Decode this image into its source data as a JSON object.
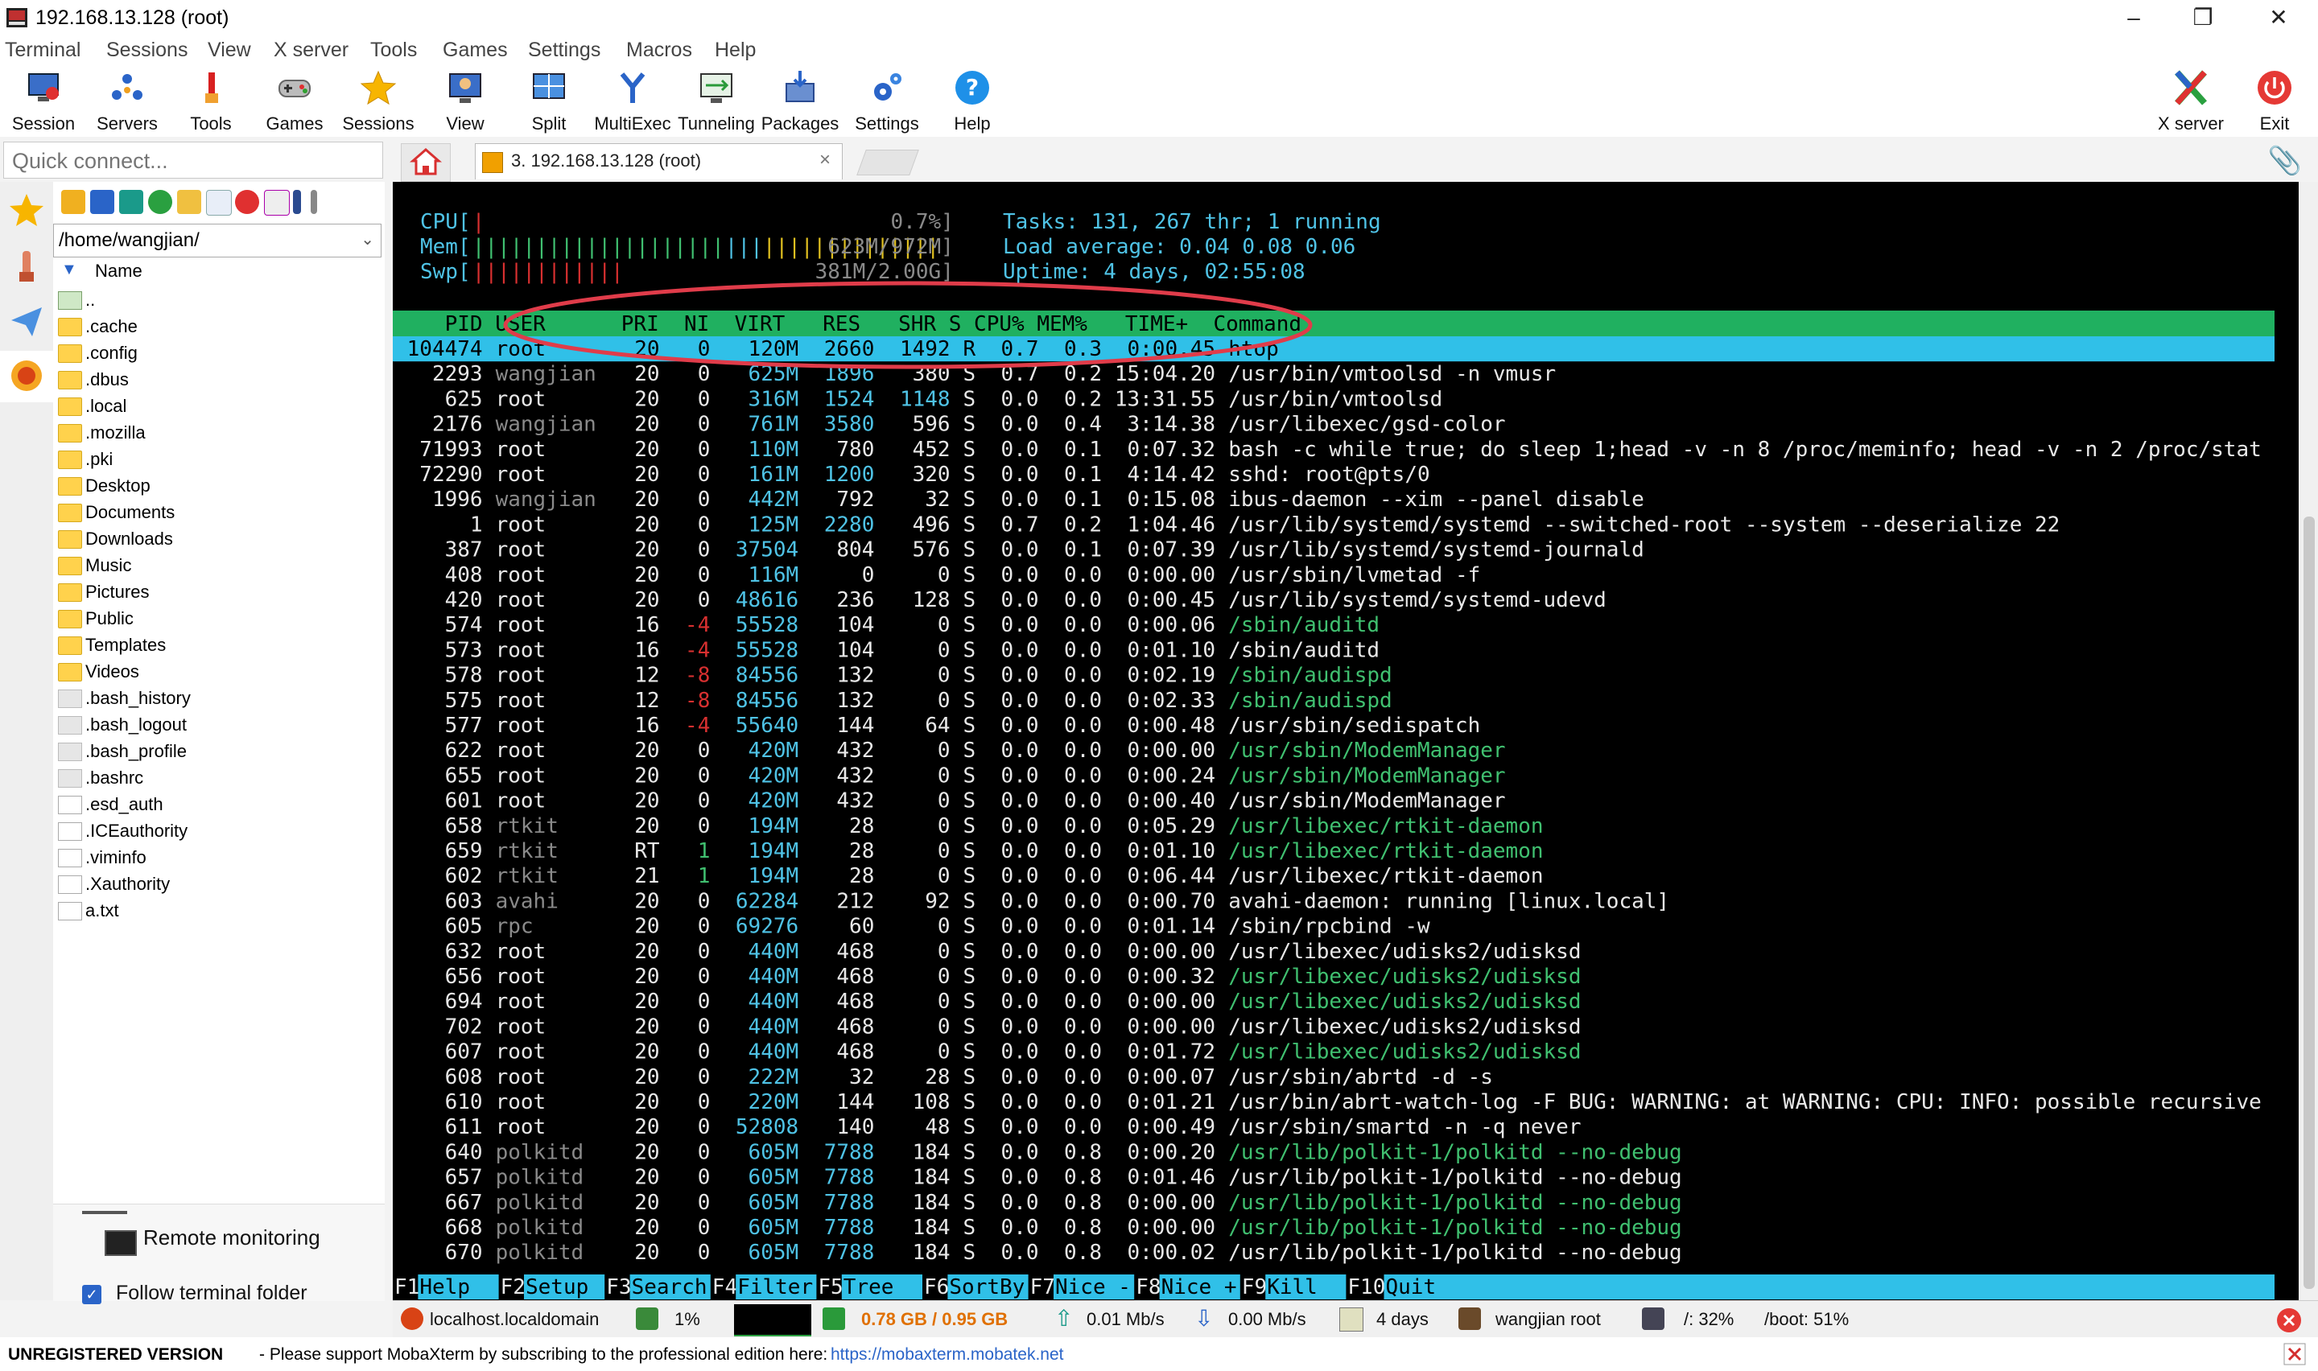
{
  "window": {
    "title": "192.168.13.128 (root)"
  },
  "menu": [
    "Terminal",
    "Sessions",
    "View",
    "X server",
    "Tools",
    "Games",
    "Settings",
    "Macros",
    "Help"
  ],
  "toolbar": {
    "left": [
      {
        "label": "Session",
        "icon": "session-icon"
      },
      {
        "label": "Servers",
        "icon": "servers-icon"
      },
      {
        "label": "Tools",
        "icon": "tools-icon"
      },
      {
        "label": "Games",
        "icon": "games-icon"
      },
      {
        "label": "Sessions",
        "icon": "star-icon"
      },
      {
        "label": "View",
        "icon": "view-icon"
      },
      {
        "label": "Split",
        "icon": "split-icon"
      },
      {
        "label": "MultiExec",
        "icon": "multiexec-icon"
      },
      {
        "label": "Tunneling",
        "icon": "tunneling-icon"
      },
      {
        "label": "Packages",
        "icon": "packages-icon"
      },
      {
        "label": "Settings",
        "icon": "settings-icon"
      },
      {
        "label": "Help",
        "icon": "help-icon"
      }
    ],
    "right": [
      {
        "label": "X server",
        "icon": "xserver-icon"
      },
      {
        "label": "Exit",
        "icon": "exit-icon"
      }
    ]
  },
  "quick_connect": {
    "placeholder": "Quick connect..."
  },
  "tab": {
    "label": "3. 192.168.13.128 (root)",
    "close": "×"
  },
  "sidebar": {
    "path": "/home/wangjian/",
    "column": "Name",
    "files": [
      {
        "name": "..",
        "kind": "up"
      },
      {
        "name": ".cache",
        "kind": "folder"
      },
      {
        "name": ".config",
        "kind": "folder"
      },
      {
        "name": ".dbus",
        "kind": "folder"
      },
      {
        "name": ".local",
        "kind": "folder"
      },
      {
        "name": ".mozilla",
        "kind": "folder"
      },
      {
        "name": ".pki",
        "kind": "folder"
      },
      {
        "name": "Desktop",
        "kind": "folder"
      },
      {
        "name": "Documents",
        "kind": "folder"
      },
      {
        "name": "Downloads",
        "kind": "folder"
      },
      {
        "name": "Music",
        "kind": "folder"
      },
      {
        "name": "Pictures",
        "kind": "folder"
      },
      {
        "name": "Public",
        "kind": "folder"
      },
      {
        "name": "Templates",
        "kind": "folder"
      },
      {
        "name": "Videos",
        "kind": "folder"
      },
      {
        "name": ".bash_history",
        "kind": "file"
      },
      {
        "name": ".bash_logout",
        "kind": "file"
      },
      {
        "name": ".bash_profile",
        "kind": "file"
      },
      {
        "name": ".bashrc",
        "kind": "file"
      },
      {
        "name": ".esd_auth",
        "kind": "doc"
      },
      {
        "name": ".ICEauthority",
        "kind": "doc"
      },
      {
        "name": ".viminfo",
        "kind": "doc"
      },
      {
        "name": ".Xauthority",
        "kind": "doc"
      },
      {
        "name": "a.txt",
        "kind": "doc"
      }
    ],
    "remote_monitoring": "Remote monitoring",
    "follow_folder": "Follow terminal folder"
  },
  "htop": {
    "cpu_label": "CPU[",
    "cpu_value": "0.7%]",
    "mem_label": "Mem[",
    "mem_value": "623M/972M]",
    "swp_label": "Swp[",
    "swp_value": "381M/2.00G]",
    "tasks": "Tasks: 131, 267 thr; 1 running",
    "load": "Load average: 0.04 0.08 0.06",
    "uptime": "Uptime: 4 days, 02:55:08",
    "header": "    PID USER      PRI  NI  VIRT   RES   SHR S CPU% MEM%   TIME+  Command",
    "rows": [
      [
        "104474",
        "root",
        "20",
        "0",
        "120M",
        "2660",
        "1492",
        "R",
        "0.7",
        "0.3",
        "0:00.45",
        "htop"
      ],
      [
        "2293",
        "wangjian",
        "20",
        "0",
        "625M",
        "1896",
        "380",
        "S",
        "0.7",
        "0.2",
        "15:04.20",
        "/usr/bin/vmtoolsd -n vmusr"
      ],
      [
        "625",
        "root",
        "20",
        "0",
        "316M",
        "1524",
        "1148",
        "S",
        "0.0",
        "0.2",
        "13:31.55",
        "/usr/bin/vmtoolsd"
      ],
      [
        "2176",
        "wangjian",
        "20",
        "0",
        "761M",
        "3580",
        "596",
        "S",
        "0.0",
        "0.4",
        "3:14.38",
        "/usr/libexec/gsd-color"
      ],
      [
        "71993",
        "root",
        "20",
        "0",
        "110M",
        "780",
        "452",
        "S",
        "0.0",
        "0.1",
        "0:07.32",
        "bash -c while true; do sleep 1;head -v -n 8 /proc/meminfo; head -v -n 2 /proc/stat"
      ],
      [
        "72290",
        "root",
        "20",
        "0",
        "161M",
        "1200",
        "320",
        "S",
        "0.0",
        "0.1",
        "4:14.42",
        "sshd: root@pts/0"
      ],
      [
        "1996",
        "wangjian",
        "20",
        "0",
        "442M",
        "792",
        "32",
        "S",
        "0.0",
        "0.1",
        "0:15.08",
        "ibus-daemon --xim --panel disable"
      ],
      [
        "1",
        "root",
        "20",
        "0",
        "125M",
        "2280",
        "496",
        "S",
        "0.7",
        "0.2",
        "1:04.46",
        "/usr/lib/systemd/systemd --switched-root --system --deserialize 22"
      ],
      [
        "387",
        "root",
        "20",
        "0",
        "37504",
        "804",
        "576",
        "S",
        "0.0",
        "0.1",
        "0:07.39",
        "/usr/lib/systemd/systemd-journald"
      ],
      [
        "408",
        "root",
        "20",
        "0",
        "116M",
        "0",
        "0",
        "S",
        "0.0",
        "0.0",
        "0:00.00",
        "/usr/sbin/lvmetad -f"
      ],
      [
        "420",
        "root",
        "20",
        "0",
        "48616",
        "236",
        "128",
        "S",
        "0.0",
        "0.0",
        "0:00.45",
        "/usr/lib/systemd/systemd-udevd"
      ],
      [
        "574",
        "root",
        "16",
        "-4",
        "55528",
        "104",
        "0",
        "S",
        "0.0",
        "0.0",
        "0:00.06",
        "/sbin/auditd"
      ],
      [
        "573",
        "root",
        "16",
        "-4",
        "55528",
        "104",
        "0",
        "S",
        "0.0",
        "0.0",
        "0:01.10",
        "/sbin/auditd"
      ],
      [
        "578",
        "root",
        "12",
        "-8",
        "84556",
        "132",
        "0",
        "S",
        "0.0",
        "0.0",
        "0:02.19",
        "/sbin/audispd"
      ],
      [
        "575",
        "root",
        "12",
        "-8",
        "84556",
        "132",
        "0",
        "S",
        "0.0",
        "0.0",
        "0:02.33",
        "/sbin/audispd"
      ],
      [
        "577",
        "root",
        "16",
        "-4",
        "55640",
        "144",
        "64",
        "S",
        "0.0",
        "0.0",
        "0:00.48",
        "/usr/sbin/sedispatch"
      ],
      [
        "622",
        "root",
        "20",
        "0",
        "420M",
        "432",
        "0",
        "S",
        "0.0",
        "0.0",
        "0:00.00",
        "/usr/sbin/ModemManager"
      ],
      [
        "655",
        "root",
        "20",
        "0",
        "420M",
        "432",
        "0",
        "S",
        "0.0",
        "0.0",
        "0:00.24",
        "/usr/sbin/ModemManager"
      ],
      [
        "601",
        "root",
        "20",
        "0",
        "420M",
        "432",
        "0",
        "S",
        "0.0",
        "0.0",
        "0:00.40",
        "/usr/sbin/ModemManager"
      ],
      [
        "658",
        "rtkit",
        "20",
        "0",
        "194M",
        "28",
        "0",
        "S",
        "0.0",
        "0.0",
        "0:05.29",
        "/usr/libexec/rtkit-daemon"
      ],
      [
        "659",
        "rtkit",
        "RT",
        "1",
        "194M",
        "28",
        "0",
        "S",
        "0.0",
        "0.0",
        "0:01.10",
        "/usr/libexec/rtkit-daemon"
      ],
      [
        "602",
        "rtkit",
        "21",
        "1",
        "194M",
        "28",
        "0",
        "S",
        "0.0",
        "0.0",
        "0:06.44",
        "/usr/libexec/rtkit-daemon"
      ],
      [
        "603",
        "avahi",
        "20",
        "0",
        "62284",
        "212",
        "92",
        "S",
        "0.0",
        "0.0",
        "0:00.70",
        "avahi-daemon: running [linux.local]"
      ],
      [
        "605",
        "rpc",
        "20",
        "0",
        "69276",
        "60",
        "0",
        "S",
        "0.0",
        "0.0",
        "0:01.14",
        "/sbin/rpcbind -w"
      ],
      [
        "632",
        "root",
        "20",
        "0",
        "440M",
        "468",
        "0",
        "S",
        "0.0",
        "0.0",
        "0:00.00",
        "/usr/libexec/udisks2/udisksd"
      ],
      [
        "656",
        "root",
        "20",
        "0",
        "440M",
        "468",
        "0",
        "S",
        "0.0",
        "0.0",
        "0:00.32",
        "/usr/libexec/udisks2/udisksd"
      ],
      [
        "694",
        "root",
        "20",
        "0",
        "440M",
        "468",
        "0",
        "S",
        "0.0",
        "0.0",
        "0:00.00",
        "/usr/libexec/udisks2/udisksd"
      ],
      [
        "702",
        "root",
        "20",
        "0",
        "440M",
        "468",
        "0",
        "S",
        "0.0",
        "0.0",
        "0:00.00",
        "/usr/libexec/udisks2/udisksd"
      ],
      [
        "607",
        "root",
        "20",
        "0",
        "440M",
        "468",
        "0",
        "S",
        "0.0",
        "0.0",
        "0:01.72",
        "/usr/libexec/udisks2/udisksd"
      ],
      [
        "608",
        "root",
        "20",
        "0",
        "222M",
        "32",
        "28",
        "S",
        "0.0",
        "0.0",
        "0:00.07",
        "/usr/sbin/abrtd -d -s"
      ],
      [
        "610",
        "root",
        "20",
        "0",
        "220M",
        "144",
        "108",
        "S",
        "0.0",
        "0.0",
        "0:01.21",
        "/usr/bin/abrt-watch-log -F BUG: WARNING: at WARNING: CPU: INFO: possible recursive"
      ],
      [
        "611",
        "root",
        "20",
        "0",
        "52808",
        "140",
        "48",
        "S",
        "0.0",
        "0.0",
        "0:00.49",
        "/usr/sbin/smartd -n -q never"
      ],
      [
        "640",
        "polkitd",
        "20",
        "0",
        "605M",
        "7788",
        "184",
        "S",
        "0.0",
        "0.8",
        "0:00.20",
        "/usr/lib/polkit-1/polkitd --no-debug"
      ],
      [
        "657",
        "polkitd",
        "20",
        "0",
        "605M",
        "7788",
        "184",
        "S",
        "0.0",
        "0.8",
        "0:01.46",
        "/usr/lib/polkit-1/polkitd --no-debug"
      ],
      [
        "667",
        "polkitd",
        "20",
        "0",
        "605M",
        "7788",
        "184",
        "S",
        "0.0",
        "0.8",
        "0:00.00",
        "/usr/lib/polkit-1/polkitd --no-debug"
      ],
      [
        "668",
        "polkitd",
        "20",
        "0",
        "605M",
        "7788",
        "184",
        "S",
        "0.0",
        "0.8",
        "0:00.00",
        "/usr/lib/polkit-1/polkitd --no-debug"
      ],
      [
        "670",
        "polkitd",
        "20",
        "0",
        "605M",
        "7788",
        "184",
        "S",
        "0.0",
        "0.8",
        "0:00.02",
        "/usr/lib/polkit-1/polkitd --no-debug"
      ]
    ],
    "fkeys": [
      {
        "key": "F1",
        "label": "Help  "
      },
      {
        "key": "F2",
        "label": "Setup "
      },
      {
        "key": "F3",
        "label": "Search"
      },
      {
        "key": "F4",
        "label": "Filter"
      },
      {
        "key": "F5",
        "label": "Tree  "
      },
      {
        "key": "F6",
        "label": "SortBy"
      },
      {
        "key": "F7",
        "label": "Nice -"
      },
      {
        "key": "F8",
        "label": "Nice +"
      },
      {
        "key": "F9",
        "label": "Kill  "
      },
      {
        "key": "F10",
        "label": "Quit"
      }
    ]
  },
  "status": {
    "host": "localhost.localdomain",
    "cpu": "1%",
    "mem": "0.78 GB / 0.95 GB",
    "up": "0.01 Mb/s",
    "down": "0.00 Mb/s",
    "uptime": "4 days",
    "users": "wangjian  root",
    "disk_root": "/: 32%",
    "disk_boot": "/boot: 51%"
  },
  "footer": {
    "unregistered": "UNREGISTERED VERSION",
    "message": "-  Please support MobaXterm by subscribing to the professional edition here:",
    "link": "https://mobaxterm.mobatek.net"
  },
  "colors": {
    "term_bg": "#000000",
    "header_green": "#20b060",
    "selected_cyan": "#30c0e8",
    "bar_red": "#d83030",
    "bar_yellow": "#e0c020",
    "text_cyan": "#4fc3e6",
    "text_green": "#40c070",
    "dim_gray": "#8a8a8a",
    "highlight_ellipse": "#e03c4a"
  }
}
